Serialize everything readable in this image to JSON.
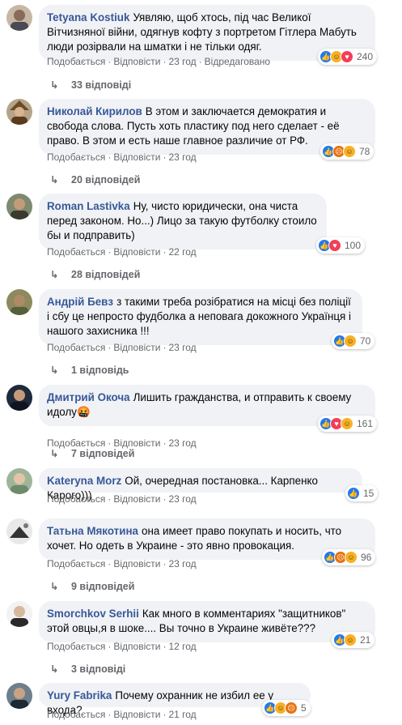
{
  "labels": {
    "like": "Подобається",
    "reply": "Відповісти",
    "edited": "Відредаговано",
    "dot": "·"
  },
  "colors": {
    "author": "#385898",
    "bubble": "#f0f2f5",
    "meta": "#65676b",
    "like": "#2078f4",
    "love": "#f33e58",
    "haha": "#f7b125",
    "angry": "#e9710f"
  },
  "comments": [
    {
      "author": "Tetyana Kostiuk",
      "text": "Уявляю, щоб хтось, під час Великої Вітчизняної війни, одягнув кофту з портретом Гітлера Мабуть люди розірвали на шматки і не тільки одяг.",
      "time": "23 год",
      "edited": true,
      "reactions": [
        "like-icon",
        "haha-icon",
        "love-icon"
      ],
      "reaction_count": "240",
      "replies": "33 відповіді"
    },
    {
      "author": "Николай Кирилов",
      "text": "В этом и заключается демократия и свобода слова. Пусть хоть пластику под него сделает - её право. В этом и есть наше главное различие от РФ.",
      "time": "23 год",
      "reactions": [
        "like-icon",
        "angry-icon",
        "haha-icon"
      ],
      "reaction_count": "78",
      "replies": "20 відповідей"
    },
    {
      "author": "Roman Lastivka",
      "text": "Ну, чисто юридически, она чиста перед законом. Но...) Лицо за такую футболку стоило бы и подправить)",
      "time": "22 год",
      "reactions": [
        "like-icon",
        "love-icon"
      ],
      "reaction_count": "100",
      "replies": "28 відповідей"
    },
    {
      "author": "Андрій Бевз",
      "text": "з такими треба розібратися на місці без поліції і сбу це непросто фудболка а неповага докожного Українця і нашого захисника !!!",
      "time": "23 год",
      "reactions": [
        "like-icon",
        "haha-icon"
      ],
      "reaction_count": "70",
      "replies": "1 відповідь"
    },
    {
      "author": "Дмитрий Окоча",
      "text": "Лишить гражданства, и отправить к своему идолу",
      "emoji": "🤬",
      "time": "23 год",
      "reactions": [
        "like-icon",
        "love-icon",
        "haha-icon"
      ],
      "reaction_count": "161",
      "replies": "7 відповідей"
    },
    {
      "author": "Kateryna Morz",
      "text": "Ой, очередная постановка... Карпенко Карого)))",
      "time": "23 год",
      "reactions": [
        "like-icon"
      ],
      "reaction_count": "15"
    },
    {
      "author": "Татьна Мякотина",
      "text": "она имеет право покупать и носить, что хочет. Но одеть в Украине - это явно провокация.",
      "time": "23 год",
      "reactions": [
        "like-icon",
        "angry-icon",
        "haha-icon"
      ],
      "reaction_count": "96",
      "replies": "9 відповідей"
    },
    {
      "author": "Smorchkov Serhii",
      "text": "Как много в комментариях \"защитников\" этой овцы,я в шоке.... Вы точно в Украине живёте???",
      "time": "12 год",
      "reactions": [
        "like-icon",
        "haha-icon"
      ],
      "reaction_count": "21",
      "replies": "3 відповіді"
    },
    {
      "author": "Yury Fabrika",
      "text": "Почему охранник не избил ее у входа?",
      "time": "21 год",
      "reactions": [
        "like-icon",
        "haha-icon",
        "angry-icon"
      ],
      "reaction_count": "5"
    }
  ]
}
